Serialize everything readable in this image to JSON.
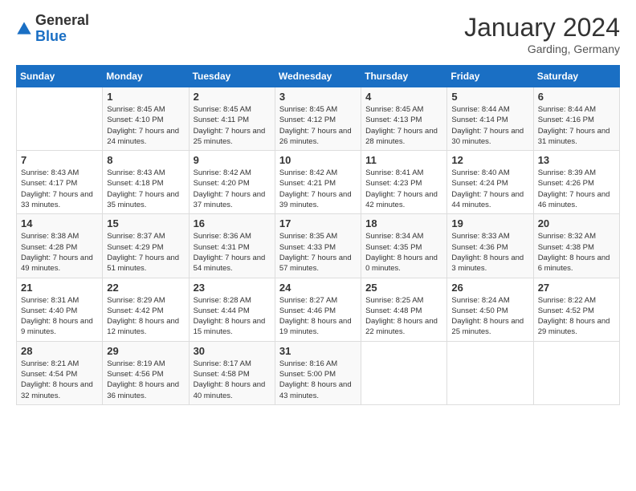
{
  "header": {
    "logo": {
      "text_general": "General",
      "text_blue": "Blue"
    },
    "title": "January 2024",
    "location": "Garding, Germany"
  },
  "calendar": {
    "days_of_week": [
      "Sunday",
      "Monday",
      "Tuesday",
      "Wednesday",
      "Thursday",
      "Friday",
      "Saturday"
    ],
    "weeks": [
      [
        {
          "day": "",
          "sunrise": "",
          "sunset": "",
          "daylight": ""
        },
        {
          "day": "1",
          "sunrise": "Sunrise: 8:45 AM",
          "sunset": "Sunset: 4:10 PM",
          "daylight": "Daylight: 7 hours and 24 minutes."
        },
        {
          "day": "2",
          "sunrise": "Sunrise: 8:45 AM",
          "sunset": "Sunset: 4:11 PM",
          "daylight": "Daylight: 7 hours and 25 minutes."
        },
        {
          "day": "3",
          "sunrise": "Sunrise: 8:45 AM",
          "sunset": "Sunset: 4:12 PM",
          "daylight": "Daylight: 7 hours and 26 minutes."
        },
        {
          "day": "4",
          "sunrise": "Sunrise: 8:45 AM",
          "sunset": "Sunset: 4:13 PM",
          "daylight": "Daylight: 7 hours and 28 minutes."
        },
        {
          "day": "5",
          "sunrise": "Sunrise: 8:44 AM",
          "sunset": "Sunset: 4:14 PM",
          "daylight": "Daylight: 7 hours and 30 minutes."
        },
        {
          "day": "6",
          "sunrise": "Sunrise: 8:44 AM",
          "sunset": "Sunset: 4:16 PM",
          "daylight": "Daylight: 7 hours and 31 minutes."
        }
      ],
      [
        {
          "day": "7",
          "sunrise": "Sunrise: 8:43 AM",
          "sunset": "Sunset: 4:17 PM",
          "daylight": "Daylight: 7 hours and 33 minutes."
        },
        {
          "day": "8",
          "sunrise": "Sunrise: 8:43 AM",
          "sunset": "Sunset: 4:18 PM",
          "daylight": "Daylight: 7 hours and 35 minutes."
        },
        {
          "day": "9",
          "sunrise": "Sunrise: 8:42 AM",
          "sunset": "Sunset: 4:20 PM",
          "daylight": "Daylight: 7 hours and 37 minutes."
        },
        {
          "day": "10",
          "sunrise": "Sunrise: 8:42 AM",
          "sunset": "Sunset: 4:21 PM",
          "daylight": "Daylight: 7 hours and 39 minutes."
        },
        {
          "day": "11",
          "sunrise": "Sunrise: 8:41 AM",
          "sunset": "Sunset: 4:23 PM",
          "daylight": "Daylight: 7 hours and 42 minutes."
        },
        {
          "day": "12",
          "sunrise": "Sunrise: 8:40 AM",
          "sunset": "Sunset: 4:24 PM",
          "daylight": "Daylight: 7 hours and 44 minutes."
        },
        {
          "day": "13",
          "sunrise": "Sunrise: 8:39 AM",
          "sunset": "Sunset: 4:26 PM",
          "daylight": "Daylight: 7 hours and 46 minutes."
        }
      ],
      [
        {
          "day": "14",
          "sunrise": "Sunrise: 8:38 AM",
          "sunset": "Sunset: 4:28 PM",
          "daylight": "Daylight: 7 hours and 49 minutes."
        },
        {
          "day": "15",
          "sunrise": "Sunrise: 8:37 AM",
          "sunset": "Sunset: 4:29 PM",
          "daylight": "Daylight: 7 hours and 51 minutes."
        },
        {
          "day": "16",
          "sunrise": "Sunrise: 8:36 AM",
          "sunset": "Sunset: 4:31 PM",
          "daylight": "Daylight: 7 hours and 54 minutes."
        },
        {
          "day": "17",
          "sunrise": "Sunrise: 8:35 AM",
          "sunset": "Sunset: 4:33 PM",
          "daylight": "Daylight: 7 hours and 57 minutes."
        },
        {
          "day": "18",
          "sunrise": "Sunrise: 8:34 AM",
          "sunset": "Sunset: 4:35 PM",
          "daylight": "Daylight: 8 hours and 0 minutes."
        },
        {
          "day": "19",
          "sunrise": "Sunrise: 8:33 AM",
          "sunset": "Sunset: 4:36 PM",
          "daylight": "Daylight: 8 hours and 3 minutes."
        },
        {
          "day": "20",
          "sunrise": "Sunrise: 8:32 AM",
          "sunset": "Sunset: 4:38 PM",
          "daylight": "Daylight: 8 hours and 6 minutes."
        }
      ],
      [
        {
          "day": "21",
          "sunrise": "Sunrise: 8:31 AM",
          "sunset": "Sunset: 4:40 PM",
          "daylight": "Daylight: 8 hours and 9 minutes."
        },
        {
          "day": "22",
          "sunrise": "Sunrise: 8:29 AM",
          "sunset": "Sunset: 4:42 PM",
          "daylight": "Daylight: 8 hours and 12 minutes."
        },
        {
          "day": "23",
          "sunrise": "Sunrise: 8:28 AM",
          "sunset": "Sunset: 4:44 PM",
          "daylight": "Daylight: 8 hours and 15 minutes."
        },
        {
          "day": "24",
          "sunrise": "Sunrise: 8:27 AM",
          "sunset": "Sunset: 4:46 PM",
          "daylight": "Daylight: 8 hours and 19 minutes."
        },
        {
          "day": "25",
          "sunrise": "Sunrise: 8:25 AM",
          "sunset": "Sunset: 4:48 PM",
          "daylight": "Daylight: 8 hours and 22 minutes."
        },
        {
          "day": "26",
          "sunrise": "Sunrise: 8:24 AM",
          "sunset": "Sunset: 4:50 PM",
          "daylight": "Daylight: 8 hours and 25 minutes."
        },
        {
          "day": "27",
          "sunrise": "Sunrise: 8:22 AM",
          "sunset": "Sunset: 4:52 PM",
          "daylight": "Daylight: 8 hours and 29 minutes."
        }
      ],
      [
        {
          "day": "28",
          "sunrise": "Sunrise: 8:21 AM",
          "sunset": "Sunset: 4:54 PM",
          "daylight": "Daylight: 8 hours and 32 minutes."
        },
        {
          "day": "29",
          "sunrise": "Sunrise: 8:19 AM",
          "sunset": "Sunset: 4:56 PM",
          "daylight": "Daylight: 8 hours and 36 minutes."
        },
        {
          "day": "30",
          "sunrise": "Sunrise: 8:17 AM",
          "sunset": "Sunset: 4:58 PM",
          "daylight": "Daylight: 8 hours and 40 minutes."
        },
        {
          "day": "31",
          "sunrise": "Sunrise: 8:16 AM",
          "sunset": "Sunset: 5:00 PM",
          "daylight": "Daylight: 8 hours and 43 minutes."
        },
        {
          "day": "",
          "sunrise": "",
          "sunset": "",
          "daylight": ""
        },
        {
          "day": "",
          "sunrise": "",
          "sunset": "",
          "daylight": ""
        },
        {
          "day": "",
          "sunrise": "",
          "sunset": "",
          "daylight": ""
        }
      ]
    ]
  }
}
